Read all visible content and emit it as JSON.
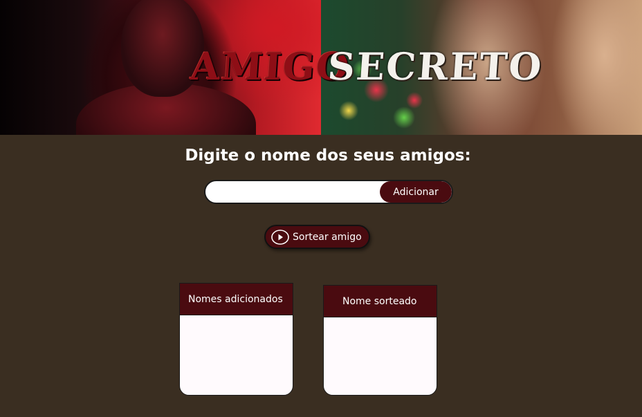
{
  "banner": {
    "title_left": "Amigo",
    "title_right": "Secreto"
  },
  "form": {
    "prompt": "Digite o nome dos seus amigos:",
    "input_value": "",
    "input_placeholder": "",
    "add_label": "Adicionar"
  },
  "draw": {
    "label": "Sortear amigo",
    "icon": "play-circle-icon"
  },
  "panels": {
    "added": {
      "title": "Nomes adicionados",
      "items": []
    },
    "drawn": {
      "title": "Nome sorteado",
      "items": []
    }
  },
  "colors": {
    "background": "#3a2e21",
    "accent": "#4a0b10",
    "panel_body": "#fffafd"
  }
}
